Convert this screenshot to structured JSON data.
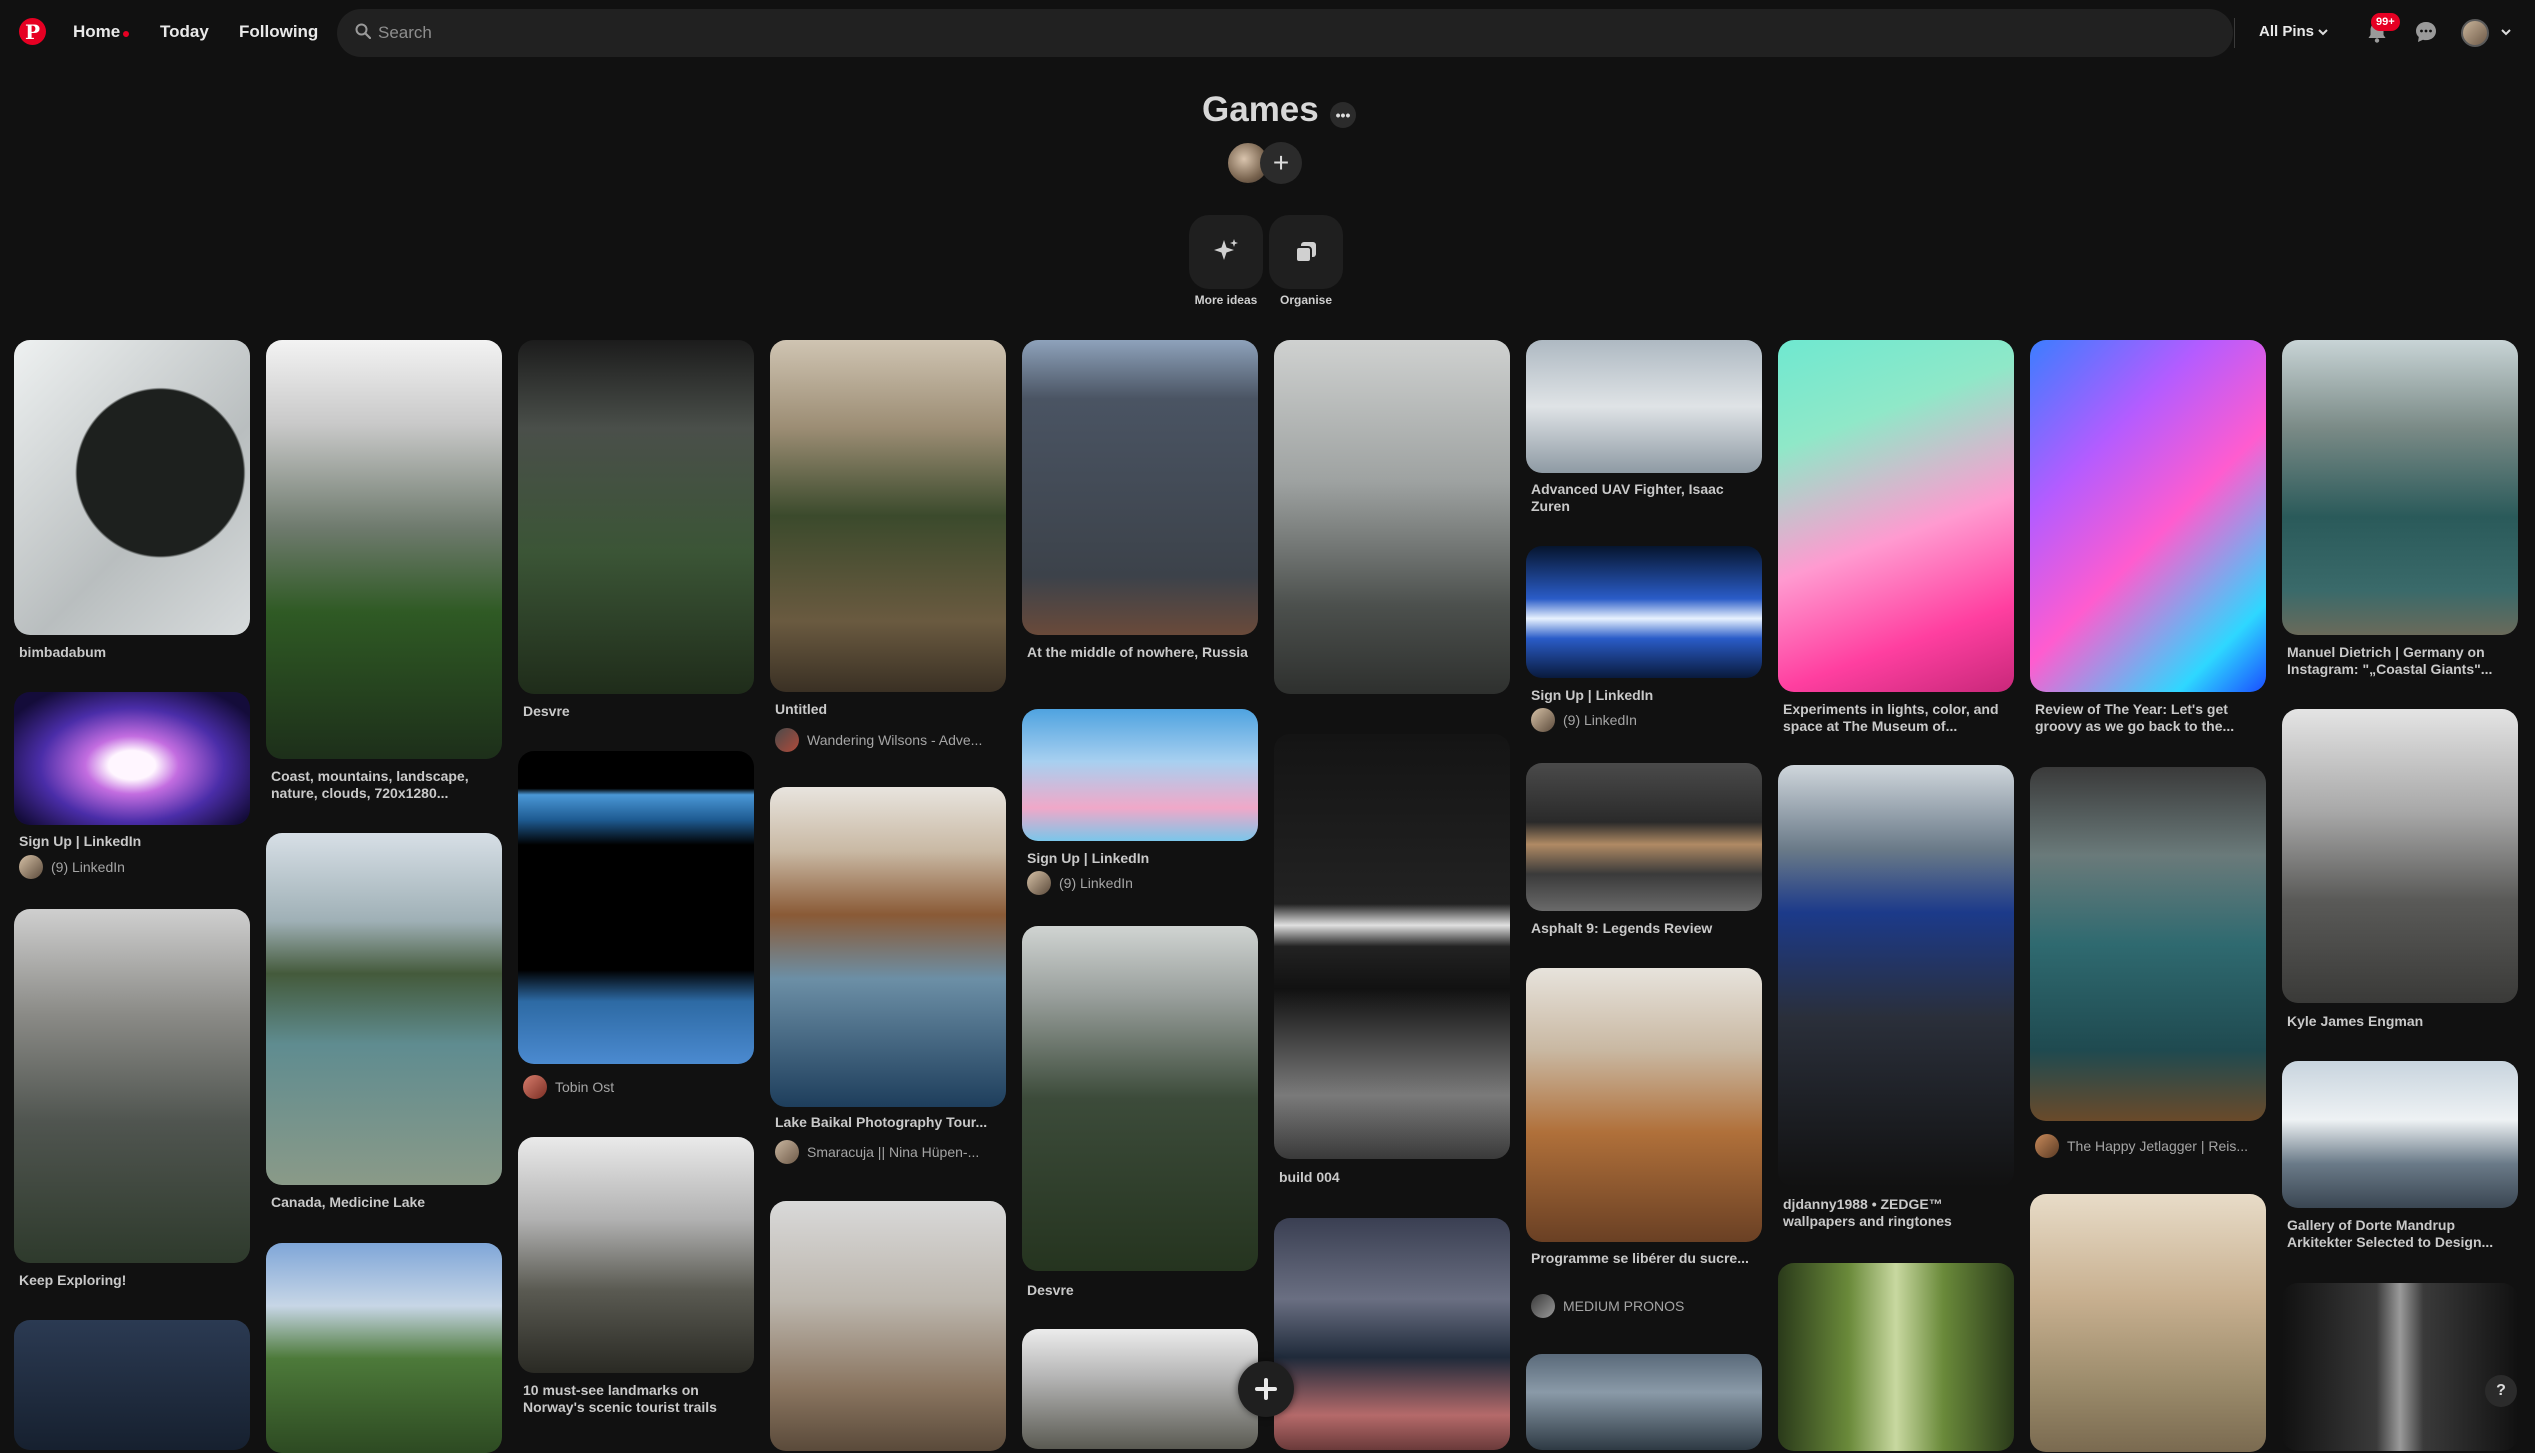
{
  "nav": {
    "home": "Home",
    "today": "Today",
    "following": "Following",
    "search_placeholder": "Search",
    "all_pins": "All Pins",
    "notification_badge": "99+"
  },
  "board": {
    "title": "Games",
    "more_ideas": "More ideas",
    "organise": "Organise"
  },
  "pins": {
    "c1": [
      "bimbadabum",
      "Sign Up | LinkedIn",
      "(9) LinkedIn",
      "Keep Exploring!"
    ],
    "c2": [
      "Coast, mountains, landscape, nature, clouds, 720x1280...",
      "Canada, Medicine Lake"
    ],
    "c3": [
      "Desvre",
      "Tobin Ost",
      "10 must-see landmarks on Norway's scenic tourist trails"
    ],
    "c4": [
      "Untitled",
      "Wandering Wilsons - Adve...",
      "Lake Baikal Photography Tour...",
      "Smaracuja || Nina Hüpen-..."
    ],
    "c5": [
      "At the middle of nowhere, Russia",
      "Sign Up | LinkedIn",
      "(9) LinkedIn",
      "Desvre"
    ],
    "c6": [
      "build 004"
    ],
    "c7": [
      "Advanced UAV Fighter, Isaac Zuren",
      "Sign Up | LinkedIn",
      "(9) LinkedIn",
      "Asphalt 9: Legends Review",
      "Programme se libérer du sucre...",
      "MEDIUM PRONOS"
    ],
    "c8": [
      "Experiments in lights, color, and space at The Museum of...",
      "djdanny1988 • ZEDGE™ wallpapers and ringtones"
    ],
    "c9": [
      "Review of The Year: Let's get groovy as we go back to the...",
      "The Happy Jetlagger | Reis..."
    ],
    "c10": [
      "Manuel Dietrich | Germany on Instagram: \"„Coastal Giants\"...",
      "Kyle James Engman",
      "Gallery of Dorte Mandrup Arkitekter Selected to Design..."
    ]
  },
  "help": "?",
  "colors": {
    "brand": "#e60023",
    "background": "#111111",
    "surface": "#212121"
  }
}
